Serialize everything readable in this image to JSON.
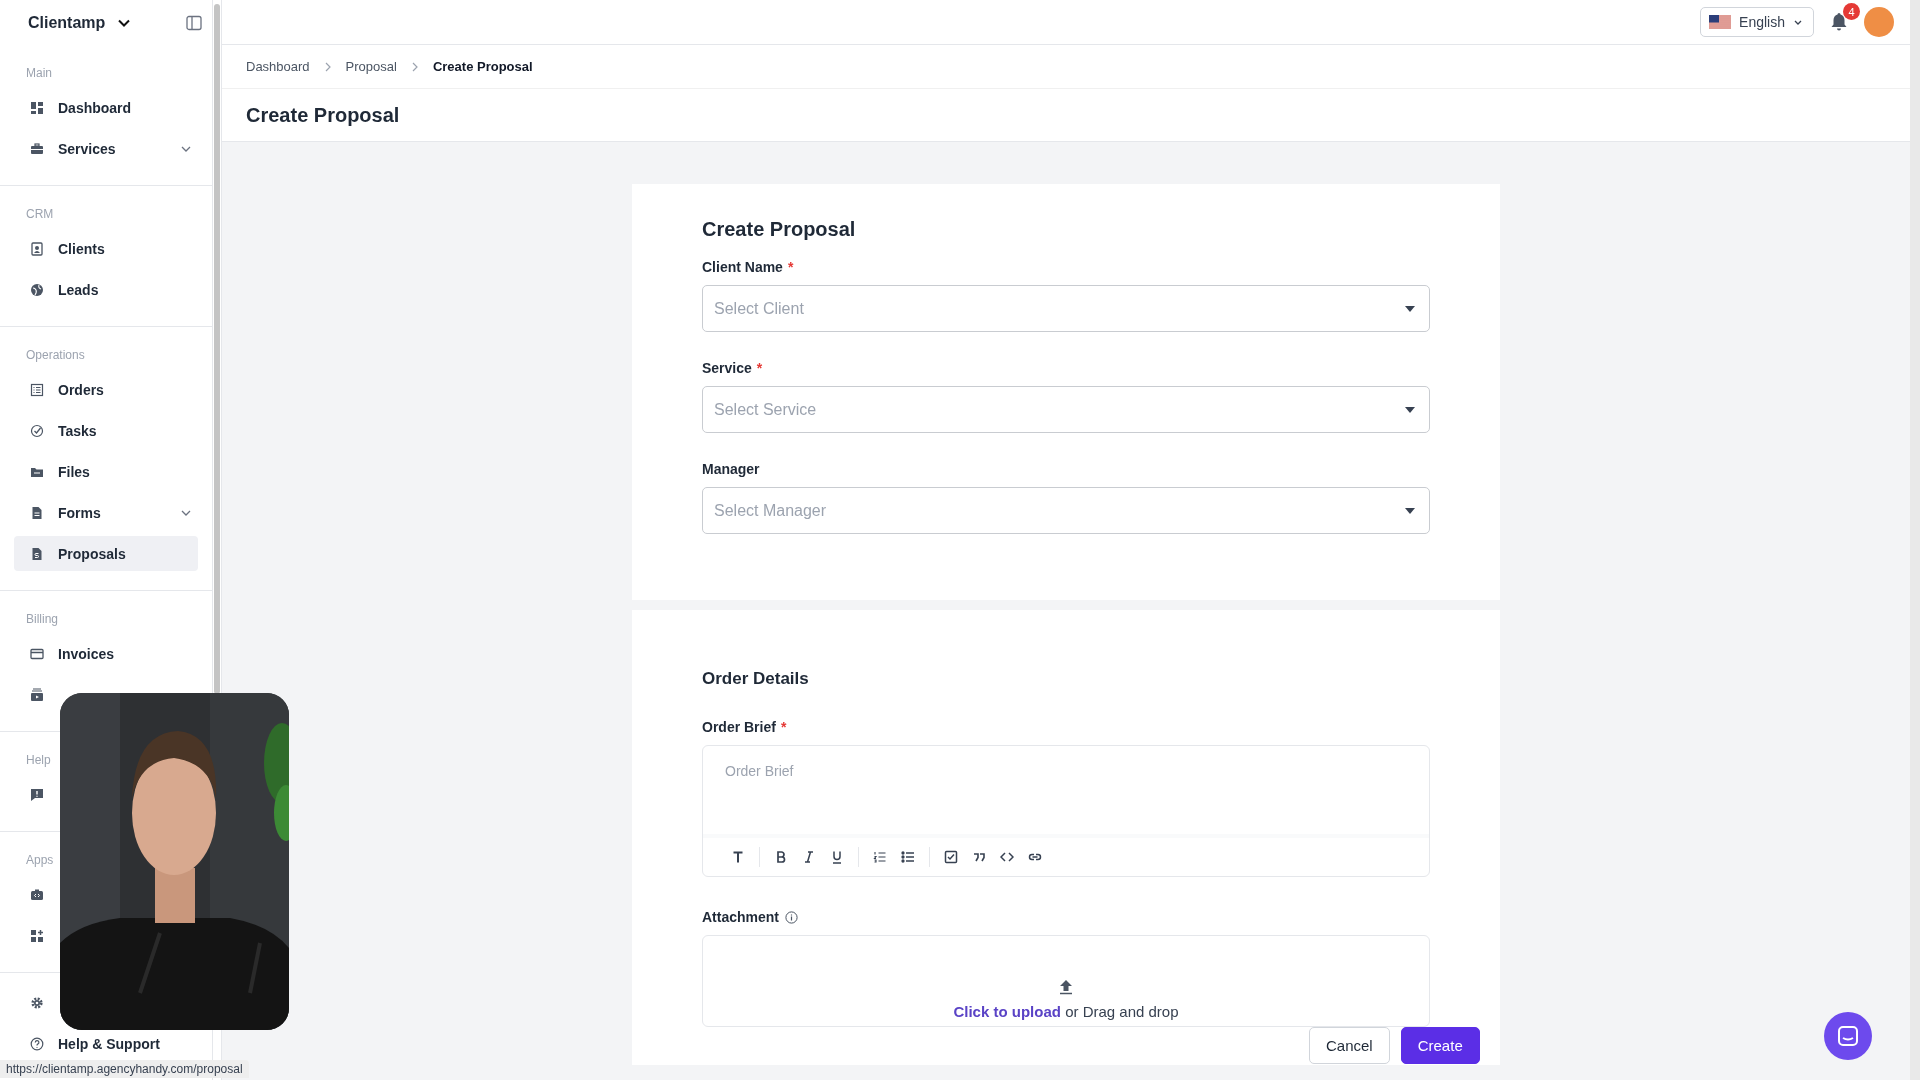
{
  "sidebar": {
    "workspace": "Clientamp",
    "sections": [
      {
        "title": "Main",
        "items": [
          {
            "label": "Dashboard",
            "has_submenu": false,
            "selected": false
          },
          {
            "label": "Services",
            "has_submenu": true,
            "selected": false
          }
        ]
      },
      {
        "title": "CRM",
        "items": [
          {
            "label": "Clients",
            "has_submenu": false,
            "selected": false
          },
          {
            "label": "Leads",
            "has_submenu": false,
            "selected": false
          }
        ]
      },
      {
        "title": "Operations",
        "items": [
          {
            "label": "Orders",
            "has_submenu": false,
            "selected": false
          },
          {
            "label": "Tasks",
            "has_submenu": false,
            "selected": false
          },
          {
            "label": "Files",
            "has_submenu": false,
            "selected": false
          },
          {
            "label": "Forms",
            "has_submenu": true,
            "selected": false
          },
          {
            "label": "Proposals",
            "has_submenu": false,
            "selected": true
          }
        ]
      },
      {
        "title": "Billing",
        "items": [
          {
            "label": "Invoices",
            "has_submenu": false,
            "selected": false
          },
          {
            "has_submenu": false,
            "selected": false
          }
        ]
      },
      {
        "title": "Help",
        "items": [
          {
            "has_submenu": false,
            "selected": false
          }
        ]
      },
      {
        "title": "Apps",
        "items": [
          {
            "has_submenu": false,
            "selected": false
          },
          {
            "has_submenu": false,
            "selected": false
          }
        ]
      },
      {
        "items": [
          {
            "has_submenu": false,
            "selected": false
          },
          {
            "label": "Help & Support",
            "has_submenu": false,
            "selected": false
          }
        ]
      }
    ]
  },
  "topbar": {
    "language": "English",
    "notification_count": "4"
  },
  "breadcrumb": [
    {
      "label": "Dashboard",
      "current": false
    },
    {
      "label": "Proposal",
      "current": false
    },
    {
      "label": "Create Proposal",
      "current": true
    }
  ],
  "page_title": "Create Proposal",
  "required_marker": "*",
  "proposal_card": {
    "title": "Create Proposal",
    "fields": [
      {
        "label": "Client Name",
        "required": true,
        "placeholder": "Select Client"
      },
      {
        "label": "Service",
        "required": true,
        "placeholder": "Select Service"
      },
      {
        "label": "Manager",
        "required": false,
        "placeholder": "Select Manager"
      }
    ]
  },
  "order_card": {
    "title": "Order Details",
    "brief": {
      "label": "Order Brief",
      "required": true,
      "placeholder": "Order Brief"
    },
    "toolbar": [
      {
        "kind": "heading"
      },
      {
        "kind": "divider"
      },
      {
        "kind": "bold"
      },
      {
        "kind": "italic"
      },
      {
        "kind": "underline"
      },
      {
        "kind": "divider"
      },
      {
        "kind": "ordered-list"
      },
      {
        "kind": "bullet-list"
      },
      {
        "kind": "divider"
      },
      {
        "kind": "checklist"
      },
      {
        "kind": "quote"
      },
      {
        "kind": "code"
      },
      {
        "kind": "link"
      }
    ],
    "attachment": {
      "label": "Attachment",
      "upload_link": "Click to upload",
      "upload_text": "or Drag and drop"
    }
  },
  "buttons": {
    "cancel": "Cancel",
    "create": "Create"
  },
  "status_bar": "https://clientamp.agencyhandy.com/proposal"
}
